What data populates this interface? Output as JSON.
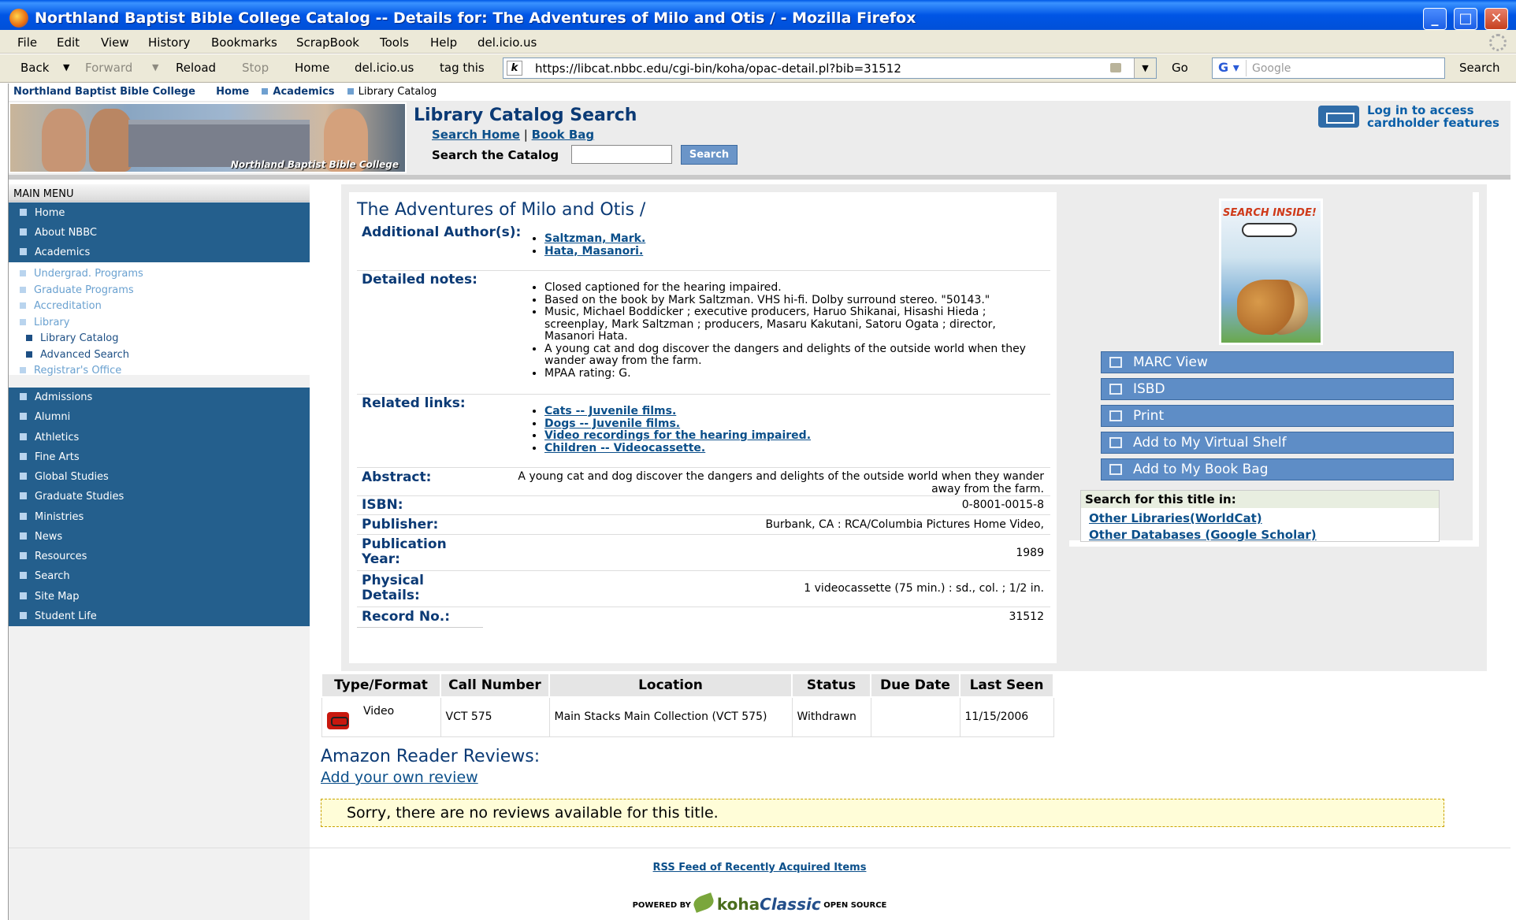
{
  "window": {
    "title": "Northland Baptist Bible College Catalog -- Details for: The Adventures of Milo and Otis / - Mozilla Firefox",
    "min": "_",
    "max": "□",
    "close": "✕"
  },
  "menubar": [
    "File",
    "Edit",
    "View",
    "History",
    "Bookmarks",
    "ScrapBook",
    "Tools",
    "Help",
    "del.icio.us"
  ],
  "navbar": {
    "back": "Back",
    "forward": "Forward",
    "reload": "Reload",
    "stop": "Stop",
    "home": "Home",
    "delicious": "del.icio.us",
    "tag": "tag this",
    "url": "https://libcat.nbbc.edu/cgi-bin/koha/opac-detail.pl?bib=31512",
    "go": "Go",
    "google_placeholder": "Google",
    "search": "Search"
  },
  "breadcrumb": {
    "college": "Northland Baptist Bible College",
    "home": "Home",
    "academics": "Academics",
    "current": "Library Catalog"
  },
  "header": {
    "banner_caption": "Northland Baptist Bible College",
    "title": "Library Catalog Search",
    "link_home": "Search Home",
    "sep": "|",
    "link_bag": "Book Bag",
    "search_label": "Search the Catalog",
    "search_btn": "Search",
    "login_line1": "Log in to access",
    "login_line2": "cardholder features"
  },
  "sidebar": {
    "heading": "MAIN MENU",
    "top": [
      "Home",
      "About NBBC",
      "Academics"
    ],
    "sub": [
      "Undergrad. Programs",
      "Graduate Programs",
      "Accreditation",
      "Library"
    ],
    "subsub": [
      "Library Catalog",
      "Advanced Search"
    ],
    "sub2": [
      "Registrar's Office"
    ],
    "bottom": [
      "Admissions",
      "Alumni",
      "Athletics",
      "Fine Arts",
      "Global Studies",
      "Graduate Studies",
      "Ministries",
      "News",
      "Resources",
      "Search",
      "Site Map",
      "Student Life"
    ]
  },
  "record": {
    "title": "The Adventures of Milo and Otis /",
    "authors_label": "Additional Author(s):",
    "authors": [
      "Saltzman, Mark.",
      "Hata, Masanori."
    ],
    "notes_label": "Detailed notes:",
    "notes": [
      "Closed captioned for the hearing impaired.",
      "Based on the book by Mark Saltzman. VHS hi-fi. Dolby surround stereo. \"50143.\"",
      "Music, Michael Boddicker ; executive producers, Haruo Shikanai, Hisashi Hieda ; screenplay, Mark Saltzman ; producers, Masaru Kakutani, Satoru Ogata ; director, Masanori Hata.",
      "A young cat and dog discover the dangers and delights of the outside world when they wander away from the farm.",
      "MPAA rating: G."
    ],
    "related_label": "Related links:",
    "related": [
      "Cats -- Juvenile films.",
      "Dogs -- Juvenile films.",
      "Video recordings for the hearing impaired.",
      "Children -- Videocassette."
    ],
    "abstract_label": "Abstract:",
    "abstract": "A young cat and dog discover the dangers and delights of the outside world when they wander away from the farm.",
    "isbn_label": "ISBN:",
    "isbn": "0-8001-0015-8",
    "publisher_label": "Publisher:",
    "publisher": "Burbank, CA : RCA/Columbia Pictures Home Video,",
    "year_label": "Publication Year:",
    "year": "1989",
    "physical_label": "Physical Details:",
    "physical": "1 videocassette (75 min.) : sd., col. ; 1/2 in.",
    "recno_label": "Record No.:",
    "recno": "31512"
  },
  "right": {
    "cover_text": "SEARCH INSIDE!",
    "actions": [
      "MARC View",
      "ISBD",
      "Print",
      "Add to My Virtual Shelf",
      "Add to My Book Bag"
    ],
    "find_heading": "Search for this title in:",
    "find_links": [
      "Other Libraries(WorldCat)",
      "Other Databases (Google Scholar)"
    ]
  },
  "holdings": {
    "headers": [
      "Type/Format",
      "Call Number",
      "Location",
      "Status",
      "Due Date",
      "Last Seen"
    ],
    "row": {
      "type": "Video",
      "call": "VCT 575",
      "location": "Main Stacks Main Collection (VCT 575)",
      "status": "Withdrawn",
      "due": "",
      "seen": "11/15/2006"
    }
  },
  "reviews": {
    "heading": "Amazon Reader Reviews:",
    "add": "Add your own review",
    "none": "Sorry, there are no reviews available for this title."
  },
  "footer": {
    "rss": "RSS Feed of Recently Acquired Items",
    "powered": "POWERED BY",
    "koha": "koha",
    "classic": "Classic",
    "open": "OPEN SOURCE"
  }
}
